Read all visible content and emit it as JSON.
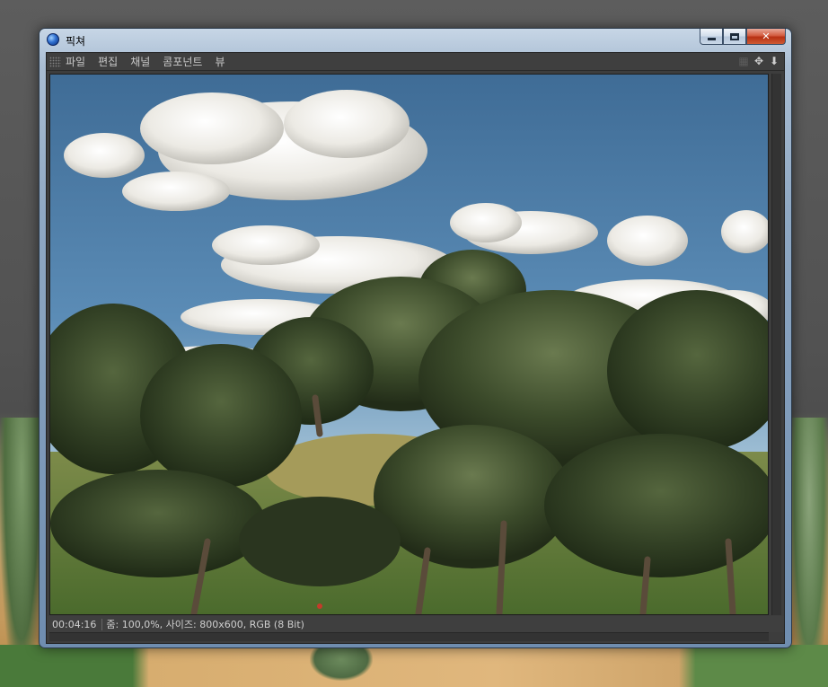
{
  "window": {
    "title": "픽쳐",
    "buttons": {
      "minimize": "minimize",
      "maximize": "maximize",
      "close": "close"
    }
  },
  "menu": {
    "items": [
      "파일",
      "편집",
      "채널",
      "콤포넌트",
      "뷰"
    ]
  },
  "toolbar_icons": [
    "pan-icon",
    "move-icon",
    "scroll-down-icon"
  ],
  "status": {
    "time": "00:04:16",
    "info": "줌: 100,0%, 사이즈: 800x600, RGB (8 Bit)"
  },
  "image": {
    "description_name": "rendered-forest-scene"
  }
}
